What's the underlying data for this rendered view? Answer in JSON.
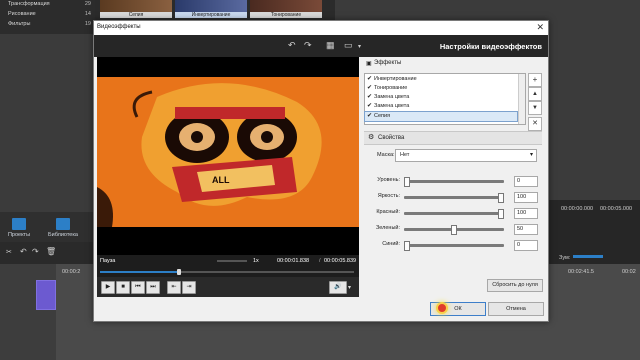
{
  "background": {
    "left_panel": {
      "items": [
        {
          "label": "Трансформация",
          "count": "29"
        },
        {
          "label": "Рисование",
          "count": "14"
        },
        {
          "label": "Фильтры",
          "count": "19"
        }
      ]
    },
    "thumbnails": [
      {
        "label": "Сепия"
      },
      {
        "label": "Инвертирование"
      },
      {
        "label": "Тонирование"
      }
    ],
    "tabs": [
      {
        "label": "Проекты"
      },
      {
        "label": "Библиотека"
      }
    ],
    "timecodes": {
      "a": "00:00:00.000",
      "b": "00:00:05.000",
      "zoom_label": "Зум:",
      "ruler1": "00:00:2",
      "ruler2": "00:02:41.5",
      "ruler3": "00:02"
    }
  },
  "dialog": {
    "title": "Видеоэффекты",
    "close": "✕",
    "heading": "Настройки видеоэффектов",
    "toolbar": {
      "undo": "↶",
      "redo": "↷",
      "grid": "▦",
      "monitor": "▭"
    },
    "player": {
      "status": "Пауза",
      "speed": "1x",
      "time_current": "00:00:01.838",
      "time_total": "00:00:05.839",
      "progress": 0.31
    },
    "effects": {
      "header": "Эффекты",
      "items": [
        {
          "label": "Инвертирование",
          "checked": true
        },
        {
          "label": "Тонирование",
          "checked": true
        },
        {
          "label": "Замена цвета",
          "checked": true
        },
        {
          "label": "Замена цвета",
          "checked": true
        },
        {
          "label": "Сепия",
          "checked": true,
          "selected": true
        }
      ],
      "side_buttons": [
        "+",
        "▲",
        "▼",
        "✕"
      ]
    },
    "properties": {
      "header": "Свойства",
      "mask_label": "Маска:",
      "mask_value": "Нет",
      "sliders": [
        {
          "label": "Уровень:",
          "value": "0",
          "level": 0.0
        },
        {
          "label": "Яркость:",
          "value": "100",
          "level": 1.0
        },
        {
          "label": "Красный:",
          "value": "100",
          "level": 1.0
        },
        {
          "label": "Зеленый:",
          "value": "50",
          "level": 0.5
        },
        {
          "label": "Синий:",
          "value": "0",
          "level": 0.0
        }
      ],
      "reset_label": "Сбросить до нуля"
    },
    "buttons": {
      "ok": "ОК",
      "cancel": "Отмена"
    }
  },
  "colors": {
    "accent": "#2c7fc7",
    "video_bg": "#e8741a",
    "dark_bar": "#262626"
  }
}
